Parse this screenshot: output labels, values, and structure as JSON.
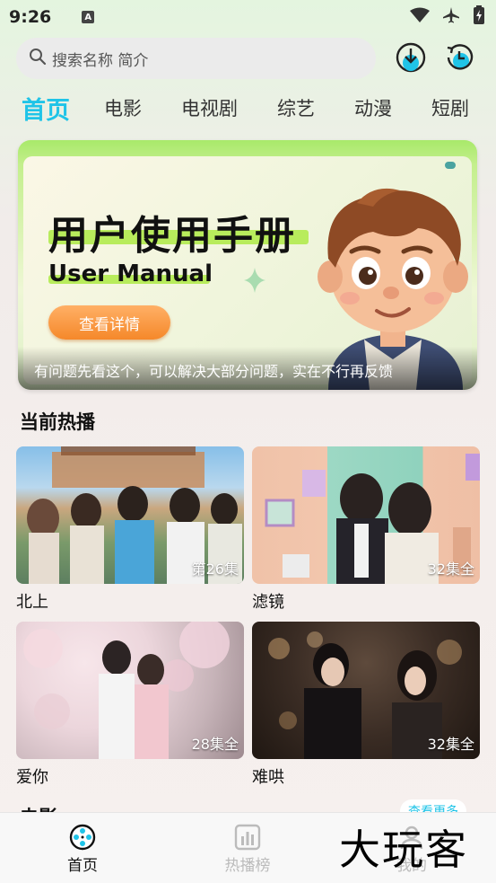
{
  "status_bar": {
    "time": "9:26",
    "notification_letter": "A"
  },
  "search": {
    "placeholder": "搜索名称 简介"
  },
  "tabs": [
    {
      "label": "首页",
      "active": true
    },
    {
      "label": "电影",
      "active": false
    },
    {
      "label": "电视剧",
      "active": false
    },
    {
      "label": "综艺",
      "active": false
    },
    {
      "label": "动漫",
      "active": false
    },
    {
      "label": "短剧",
      "active": false
    }
  ],
  "banner": {
    "title": "用户使用手册",
    "subtitle": "User Manual",
    "button_label": "查看详情",
    "caption": "有问题先看这个，可以解决大部分问题，实在不行再反馈"
  },
  "section_hot": {
    "title": "当前热播",
    "items": [
      {
        "title": "北上",
        "episodes": "第26集"
      },
      {
        "title": "滤镜",
        "episodes": "32集全"
      },
      {
        "title": "爱你",
        "episodes": "28集全"
      },
      {
        "title": "难哄",
        "episodes": "32集全"
      }
    ]
  },
  "section_movie": {
    "title": "电影",
    "more_label": "查看更多"
  },
  "bottom_nav": [
    {
      "label": "首页",
      "active": true
    },
    {
      "label": "热播榜",
      "active": false
    },
    {
      "label": "我的",
      "active": false
    }
  ],
  "watermark": "大玩客",
  "colors": {
    "accent": "#1fc4e8",
    "banner_green": "#b8ec5c",
    "button_orange": "#f5882a"
  }
}
